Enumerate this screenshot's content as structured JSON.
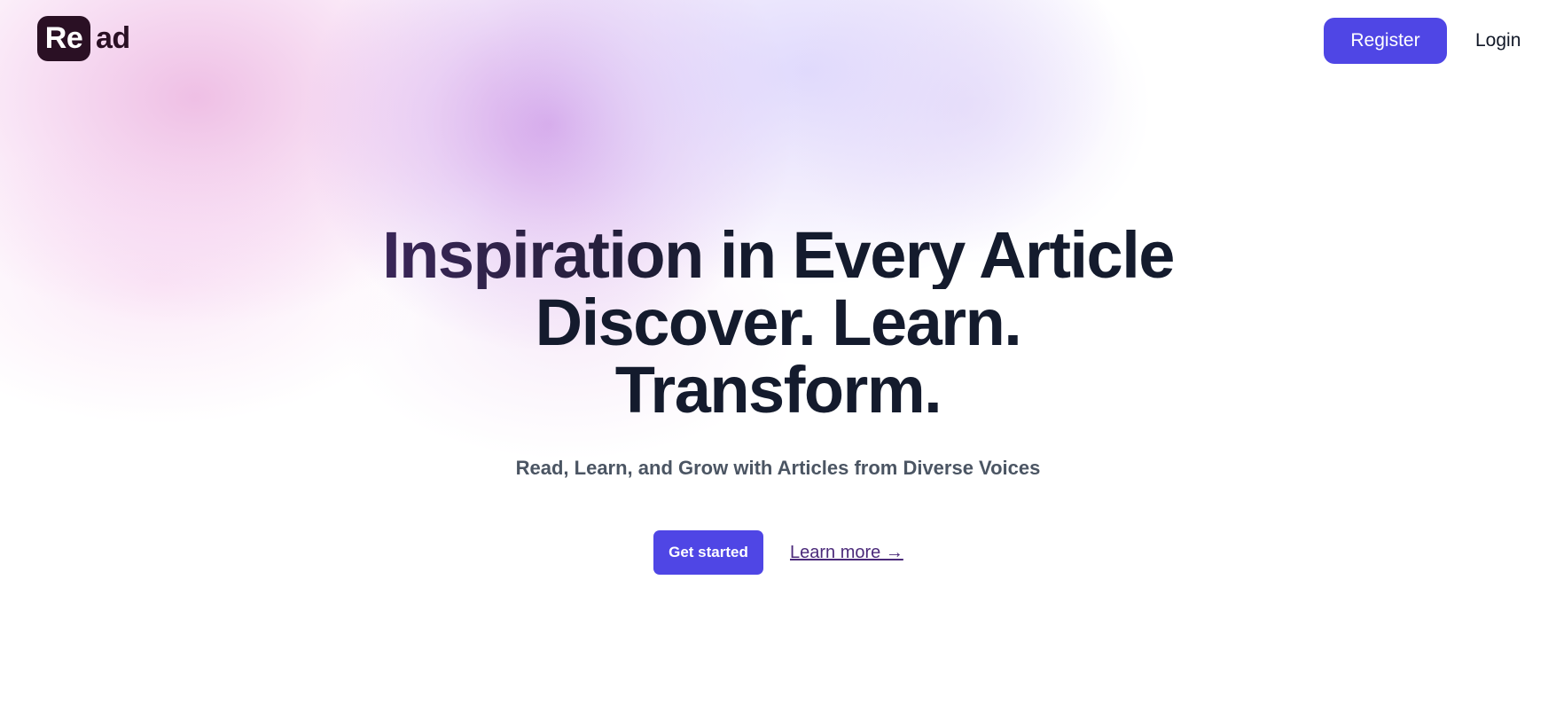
{
  "header": {
    "logo_box_text": "Re",
    "logo_rest_text": "ad",
    "register_label": "Register",
    "login_label": "Login"
  },
  "hero": {
    "title_lines": [
      "Inspiration in Every Article",
      "Discover. Learn.",
      "Transform."
    ],
    "subtitle": "Read, Learn, and Grow with Articles from Diverse Voices",
    "primary_cta": "Get started",
    "secondary_cta": "Learn more →"
  },
  "colors": {
    "accent": "#4f46e5",
    "logo_dark": "#2a1024",
    "heading": "#141b2d",
    "subtitle": "#4b5563",
    "link": "#4b2a7a"
  }
}
